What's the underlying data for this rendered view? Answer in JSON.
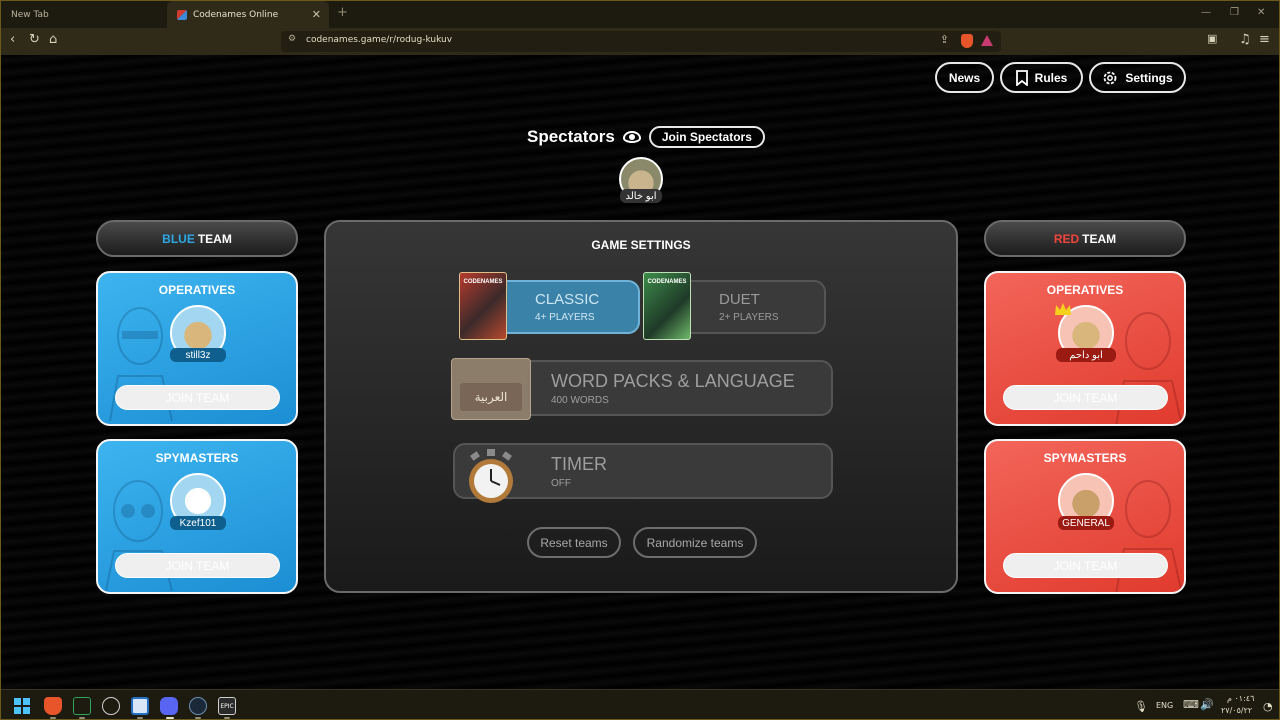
{
  "browser": {
    "tabs": [
      {
        "label": "New Tab"
      },
      {
        "label": "Codenames Online"
      }
    ],
    "url": "codenames.game/r/rodug-kukuv"
  },
  "header": {
    "news_label": "News",
    "rules_label": "Rules",
    "settings_label": "Settings"
  },
  "spectators": {
    "title": "Spectators",
    "join_label": "Join Spectators",
    "players": [
      {
        "name": "ابو خالد"
      }
    ]
  },
  "blue_team": {
    "title_color_word": "BLUE",
    "title_rest": "TEAM",
    "operatives": {
      "title": "OPERATIVES",
      "player": "still3z",
      "join_label": "JOIN TEAM"
    },
    "spymasters": {
      "title": "SPYMASTERS",
      "player": "Kzef101",
      "join_label": "JOIN TEAM"
    }
  },
  "red_team": {
    "title_color_word": "RED",
    "title_rest": "TEAM",
    "operatives": {
      "title": "OPERATIVES",
      "player": "ابو داحم",
      "join_label": "JOIN TEAM"
    },
    "spymasters": {
      "title": "SPYMASTERS",
      "player": "GENERAL",
      "join_label": "JOIN TEAM"
    }
  },
  "game_settings": {
    "title": "GAME SETTINGS",
    "modes": [
      {
        "name": "CLASSIC",
        "players": "4+ PLAYERS",
        "selected": true,
        "box_text": "CODENAMES"
      },
      {
        "name": "DUET",
        "players": "2+ PLAYERS",
        "selected": false,
        "box_text": "CODENAMES"
      }
    ],
    "word_packs": {
      "title": "WORD PACKS & LANGUAGE",
      "subtitle": "400 WORDS",
      "card_text": "العربية"
    },
    "timer": {
      "title": "TIMER",
      "subtitle": "OFF"
    },
    "reset_label": "Reset teams",
    "randomize_label": "Randomize teams"
  },
  "taskbar": {
    "language": "ENG",
    "time": "٠١:٤٦ م",
    "date": "٢٧/٠٥/٢٢"
  },
  "colors": {
    "blue": "#2aa8e8",
    "red": "#f0443a",
    "panel": "#2a2a2a"
  }
}
